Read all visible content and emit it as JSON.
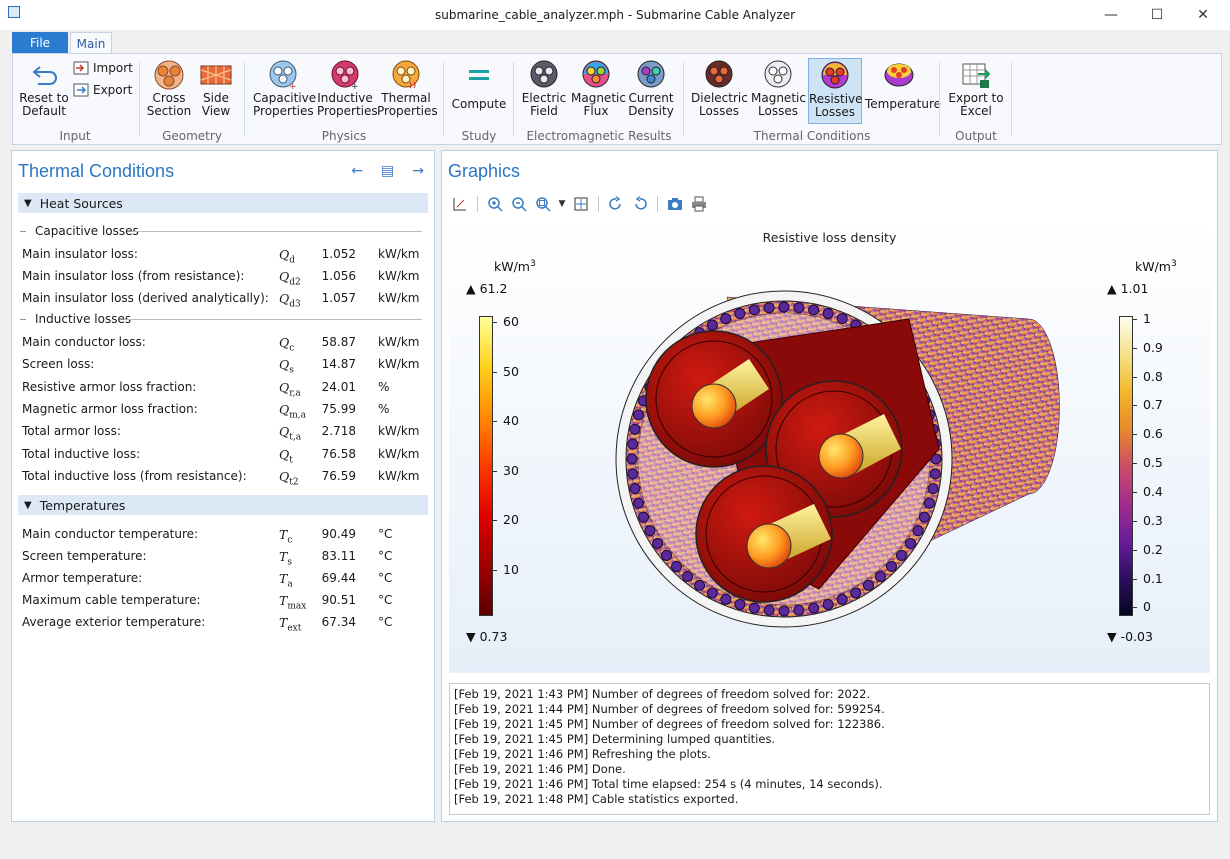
{
  "window": {
    "title": "submarine_cable_analyzer.mph - Submarine Cable Analyzer",
    "min_glyph": "—",
    "max_glyph": "☐",
    "close_glyph": "✕"
  },
  "ribbon": {
    "tabs": [
      "File",
      "Main"
    ],
    "active_tab": "Main",
    "groups": {
      "input": {
        "label": "Input",
        "reset": "Reset to Default",
        "import": "Import",
        "export": "Export"
      },
      "geometry": {
        "label": "Geometry",
        "cross_section": "Cross Section",
        "side_view": "Side View"
      },
      "physics": {
        "label": "Physics",
        "capacitive": "Capacitive Properties",
        "inductive": "Inductive Properties",
        "thermal": "Thermal Properties"
      },
      "study": {
        "label": "Study",
        "compute": "Compute"
      },
      "em_results": {
        "label": "Electromagnetic Results",
        "electric_field": "Electric Field",
        "magnetic_flux": "Magnetic Flux",
        "current_density": "Current Density"
      },
      "thermal_conditions": {
        "label": "Thermal Conditions",
        "dielectric_losses": "Dielectric Losses",
        "magnetic_losses": "Magnetic Losses",
        "resistive_losses": "Resistive Losses",
        "temperature": "Temperature",
        "selected": "Resistive Losses"
      },
      "output": {
        "label": "Output",
        "export_excel": "Export to Excel"
      }
    }
  },
  "left_panel": {
    "title": "Thermal Conditions",
    "nav_icons": [
      "arrow-left-icon",
      "table-icon",
      "arrow-right-icon"
    ],
    "heat_sources": {
      "header": "Heat Sources",
      "capacitive_label": "Capacitive losses",
      "capacitive_rows": [
        {
          "label": "Main insulator loss:",
          "sym": "Q",
          "sub": "d",
          "value": "1.052",
          "unit": "kW/km"
        },
        {
          "label": "Main insulator loss (from resistance):",
          "sym": "Q",
          "sub": "d2",
          "value": "1.056",
          "unit": "kW/km"
        },
        {
          "label": "Main insulator loss (derived analytically):",
          "sym": "Q",
          "sub": "d3",
          "value": "1.057",
          "unit": "kW/km"
        }
      ],
      "inductive_label": "Inductive losses",
      "inductive_rows": [
        {
          "label": "Main conductor loss:",
          "sym": "Q",
          "sub": "c",
          "value": "58.87",
          "unit": "kW/km"
        },
        {
          "label": "Screen loss:",
          "sym": "Q",
          "sub": "s",
          "value": "14.87",
          "unit": "kW/km"
        },
        {
          "label": "Resistive armor loss fraction:",
          "sym": "Q",
          "sub": "r,a",
          "value": "24.01",
          "unit": "%"
        },
        {
          "label": "Magnetic armor loss fraction:",
          "sym": "Q",
          "sub": "m,a",
          "value": "75.99",
          "unit": "%"
        },
        {
          "label": "Total armor loss:",
          "sym": "Q",
          "sub": "t,a",
          "value": "2.718",
          "unit": "kW/km"
        },
        {
          "label": "Total inductive loss:",
          "sym": "Q",
          "sub": "t",
          "value": "76.58",
          "unit": "kW/km"
        },
        {
          "label": "Total inductive loss (from resistance):",
          "sym": "Q",
          "sub": "t2",
          "value": "76.59",
          "unit": "kW/km"
        }
      ]
    },
    "temperatures": {
      "header": "Temperatures",
      "rows": [
        {
          "label": "Main conductor temperature:",
          "sym": "T",
          "sub": "c",
          "value": "90.49",
          "unit": "°C"
        },
        {
          "label": "Screen temperature:",
          "sym": "T",
          "sub": "s",
          "value": "83.11",
          "unit": "°C"
        },
        {
          "label": "Armor temperature:",
          "sym": "T",
          "sub": "a",
          "value": "69.44",
          "unit": "°C"
        },
        {
          "label": "Maximum cable temperature:",
          "sym": "T",
          "sub": "max",
          "value": "90.51",
          "unit": "°C"
        },
        {
          "label": "Average exterior temperature:",
          "sym": "T",
          "sub": "ext",
          "value": "67.34",
          "unit": "°C"
        }
      ]
    }
  },
  "graphics": {
    "title": "Graphics",
    "plot_title": "Resistive loss density",
    "left_colorbar": {
      "unit": "kW/m",
      "unit_exp": "3",
      "max": "▲ 61.2",
      "min": "▼ 0.73",
      "ticks": [
        "60",
        "50",
        "40",
        "30",
        "20",
        "10"
      ],
      "colors": [
        "#ffff9a",
        "#ffd21a",
        "#ff8a00",
        "#ff3a00",
        "#e00000",
        "#a00000",
        "#5a0000"
      ]
    },
    "right_colorbar": {
      "unit": "kW/m",
      "unit_exp": "3",
      "max": "▲ 1.01",
      "min": "▼ -0.03",
      "ticks": [
        "1",
        "0.9",
        "0.8",
        "0.7",
        "0.6",
        "0.5",
        "0.4",
        "0.3",
        "0.2",
        "0.1",
        "0"
      ],
      "colors": [
        "#fdfdf0",
        "#f3e28a",
        "#f2b82a",
        "#e88a2a",
        "#cc4d68",
        "#a22d8c",
        "#6a1d9c",
        "#2c0f5e",
        "#050520"
      ]
    }
  },
  "log": {
    "lines": [
      "[Feb 19, 2021 1:43 PM] Number of degrees of freedom solved for: 2022.",
      "[Feb 19, 2021 1:44 PM] Number of degrees of freedom solved for: 599254.",
      "[Feb 19, 2021 1:45 PM] Number of degrees of freedom solved for: 122386.",
      "[Feb 19, 2021 1:45 PM] Determining lumped quantities.",
      "[Feb 19, 2021 1:46 PM] Refreshing the plots.",
      "[Feb 19, 2021 1:46 PM] Done.",
      "[Feb 19, 2021 1:46 PM] Total time elapsed: 254 s (4 minutes, 14 seconds).",
      "[Feb 19, 2021 1:48 PM] Cable statistics exported."
    ]
  }
}
